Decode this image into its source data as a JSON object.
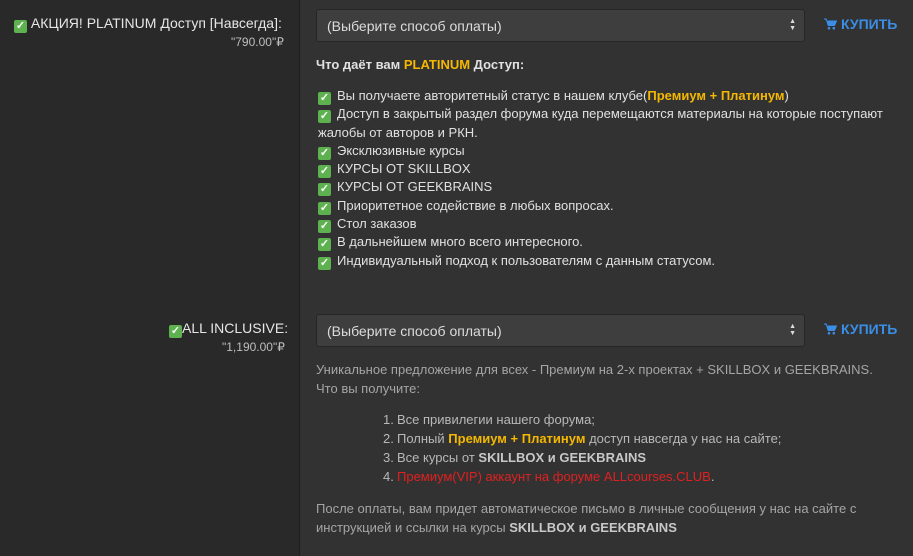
{
  "offers": [
    {
      "title": "АКЦИЯ! PLATINUM Доступ [Навсегда]:",
      "price": "\"790.00\"₽",
      "select_placeholder": "(Выберите способ оплаты)",
      "buy_label": "КУПИТЬ"
    },
    {
      "title": "ALL INCLUSIVE:",
      "price": "\"1,190.00\"₽",
      "select_placeholder": "(Выберите способ оплаты)",
      "buy_label": "КУПИТЬ"
    }
  ],
  "platinum": {
    "heading_prefix": "Что даёт вам ",
    "heading_accent": "PLATINUM",
    "heading_suffix": " Доступ:",
    "item1_text": "Вы получаете авторитетный статус в нашем клубе(",
    "item1_accent": "Премиум + Платинум",
    "item1_end": ")",
    "items": [
      "Доступ в закрытый раздел форума куда перемещаются материалы на которые поступают жалобы от авторов и РКН.",
      "Эксклюзивные курсы",
      "КУРСЫ ОТ SKILLBOX",
      "КУРСЫ ОТ GEEKBRAINS",
      "Приоритетное содействие в любых вопросах.",
      "Стол заказов",
      "В дальнейшем много всего интересного.",
      "Индивидуальный подход к пользователям с данным статусом."
    ]
  },
  "inclusive": {
    "intro": "Уникальное предложение для всех - Премиум на 2-х проектах + SKILLBOX и GEEKBRAINS. Что вы получите:",
    "li1": "Все привилегии нашего форума;",
    "li2_pre": "Полный ",
    "li2_accent": "Премиум + Платинум",
    "li2_post": " доступ навсегда у нас на сайте;",
    "li3_pre": "Все курсы от ",
    "li3_bold": "SKILLBOX и GEEKBRAINS",
    "li4": "Премиум(VIP) аккаунт на форуме ALLcourses.CLUB",
    "li4_end": ".",
    "outro_pre": "После оплаты, вам придет автоматическое письмо в личные сообщения у нас на сайте с инструкцией и ссылки на курсы ",
    "outro_bold": "SKILLBOX и GEEKBRAINS"
  },
  "numbers": [
    "1.",
    "2.",
    "3.",
    "4."
  ],
  "icons": {
    "check": "check-mark-icon",
    "cart": "cart-icon",
    "arrows": "select-arrows-icon"
  },
  "colors": {
    "accent": "#f5b800",
    "link": "#3a8ee6",
    "danger": "#e02020",
    "check": "#5db14e"
  }
}
